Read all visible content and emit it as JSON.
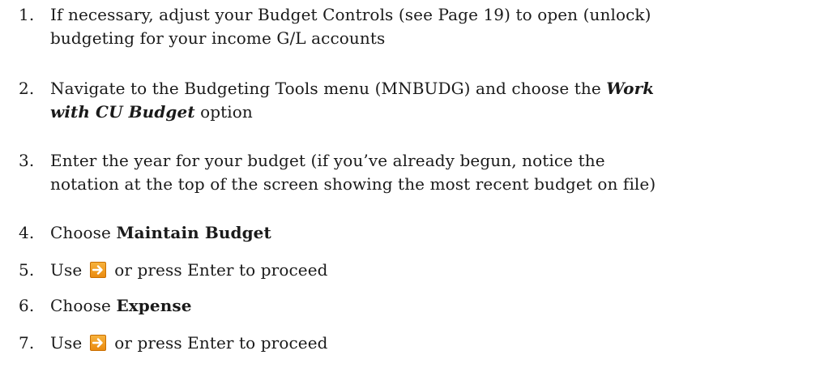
{
  "steps": [
    {
      "number": "1.",
      "line1": "If necessary, adjust your Budget Controls (see Page 19) to open (unlock)",
      "line2": "budgeting for your income G/L accounts"
    },
    {
      "number": "2.",
      "line1_before": "Navigate to the Budgeting Tools menu (MNBUDG) and choose the ",
      "line1_emph": "Work",
      "line2_emph": "with CU Budget",
      "line2_after": " option"
    },
    {
      "number": "3.",
      "line1": "Enter the year for your budget (if you’ve already begun, notice the",
      "line2": "notation at the top of the screen showing the most recent budget on file)"
    },
    {
      "number": "4.",
      "before": "Choose ",
      "emph": "Maintain Budget"
    },
    {
      "number": "5.",
      "before": "Use",
      "after": "or press Enter to proceed",
      "icon": "forward-arrow-icon"
    },
    {
      "number": "6.",
      "before": "Choose ",
      "emph": "Expense"
    },
    {
      "number": "7.",
      "before": "Use",
      "after": "or press Enter to proceed",
      "icon": "forward-arrow-icon"
    }
  ],
  "colors": {
    "text": "#1a1a1a",
    "icon_fill": "#f0a024",
    "icon_arrow": "#ffffff"
  }
}
